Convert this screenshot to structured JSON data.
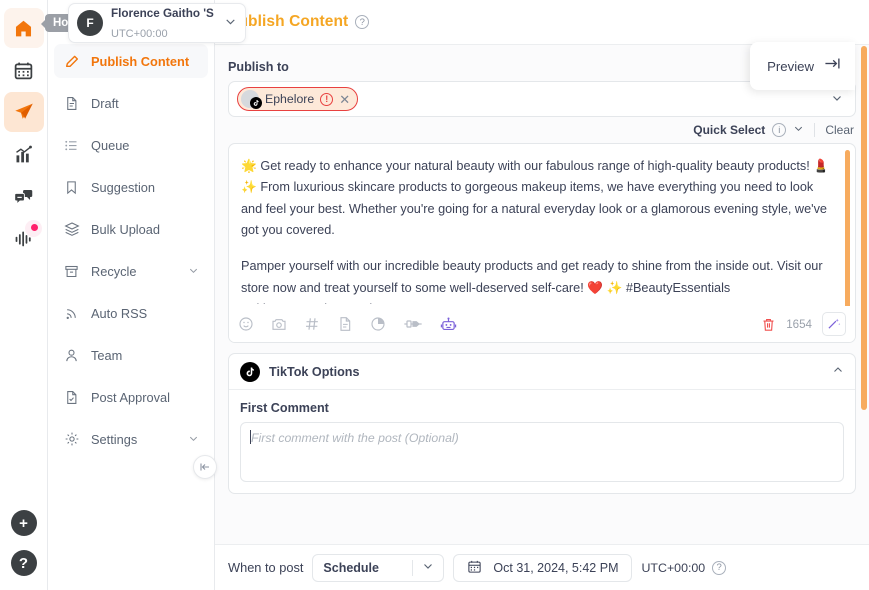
{
  "rail": {
    "items": [
      {
        "name": "home",
        "icon": "home-icon",
        "state": "hover"
      },
      {
        "name": "calendar",
        "icon": "calendar-icon",
        "state": "default"
      },
      {
        "name": "publish",
        "icon": "paper-plane-icon",
        "state": "active"
      },
      {
        "name": "analytics",
        "icon": "bar-chart-icon",
        "state": "default"
      },
      {
        "name": "inbox",
        "icon": "chat-bubbles-icon",
        "state": "default"
      },
      {
        "name": "listening",
        "icon": "waveform-icon",
        "state": "default",
        "badge": true
      }
    ],
    "add_label": "+",
    "help_label": "?"
  },
  "tooltip": {
    "home": "Home"
  },
  "workspace": {
    "avatar_initial": "F",
    "name": "Florence Gaitho 'S ...",
    "timezone": "UTC+00:00"
  },
  "header": {
    "title": "Publish Content",
    "help_icon": "question-circle-icon"
  },
  "sidebar": {
    "items": [
      {
        "label": "Publish Content",
        "icon": "pencil-icon",
        "selected": true,
        "expandable": false
      },
      {
        "label": "Draft",
        "icon": "document-icon",
        "selected": false,
        "expandable": false
      },
      {
        "label": "Queue",
        "icon": "list-icon",
        "selected": false,
        "expandable": false
      },
      {
        "label": "Suggestion",
        "icon": "bookmark-icon",
        "selected": false,
        "expandable": false
      },
      {
        "label": "Bulk Upload",
        "icon": "layers-icon",
        "selected": false,
        "expandable": false
      },
      {
        "label": "Recycle",
        "icon": "archive-icon",
        "selected": false,
        "expandable": true
      },
      {
        "label": "Auto RSS",
        "icon": "rss-icon",
        "selected": false,
        "expandable": false
      },
      {
        "label": "Team",
        "icon": "user-icon",
        "selected": false,
        "expandable": false
      },
      {
        "label": "Post Approval",
        "icon": "document-check-icon",
        "selected": false,
        "expandable": false
      },
      {
        "label": "Settings",
        "icon": "gear-icon",
        "selected": false,
        "expandable": true
      }
    ],
    "collapse_icon": "collapse-left-icon"
  },
  "preview": {
    "label": "Preview",
    "icon": "arrow-to-line-icon"
  },
  "publish_to": {
    "label": "Publish to",
    "chips": [
      {
        "name": "Ephelore",
        "platform": "tiktok",
        "has_error": true,
        "warning_icon": "exclamation-circle-icon",
        "remove_icon": "close-icon"
      }
    ],
    "dropdown_icon": "chevron-down-icon"
  },
  "quick_select": {
    "label": "Quick Select",
    "info_icon": "info-circle-icon",
    "chevron_icon": "chevron-down-icon",
    "clear_label": "Clear"
  },
  "composer": {
    "paragraphs": [
      "🌟 Get ready to enhance your natural beauty with our fabulous range of high-quality beauty products! 💄 ✨ From luxurious skincare products to gorgeous makeup items, we have everything you need to look and feel your best. Whether you're going for a natural everyday look or a glamorous evening style, we've got you covered.",
      "Pamper yourself with our incredible beauty products and get ready to shine from the inside out. Visit our store now and treat yourself to some well-deserved self-care! ❤️ ✨ #BeautyEssentials #SkincareRoutine #MakeupMustHaves"
    ],
    "char_count": "1654",
    "toolbar": [
      {
        "name": "emoji-icon"
      },
      {
        "name": "camera-icon"
      },
      {
        "name": "hashtag-icon"
      },
      {
        "name": "document-icon"
      },
      {
        "name": "pie-chart-icon"
      },
      {
        "name": "plug-icon"
      },
      {
        "name": "robot-icon"
      }
    ],
    "delete_icon": "trash-icon",
    "magic_icon": "magic-wand-icon"
  },
  "tiktok_options": {
    "title": "TikTok Options",
    "logo_icon": "tiktok-icon",
    "collapse_icon": "chevron-up-icon",
    "first_comment": {
      "label": "First Comment",
      "value": "",
      "placeholder": "First comment with the post (Optional)"
    }
  },
  "schedule_bar": {
    "when_label": "When to post",
    "mode_value": "Schedule",
    "mode_chevron": "chevron-down-icon",
    "calendar_icon": "calendar-icon",
    "datetime": "Oct 31, 2024, 5:42 PM",
    "timezone": "UTC+00:00",
    "help_icon": "question-circle-icon"
  },
  "colors": {
    "accent_orange": "#f2760c",
    "title_orange": "#f5a623",
    "error_red": "#e8403f",
    "scrollbar": "#f7ab5e",
    "robot_purple": "#7b61d9",
    "notification_pink": "#ff1f6b"
  }
}
